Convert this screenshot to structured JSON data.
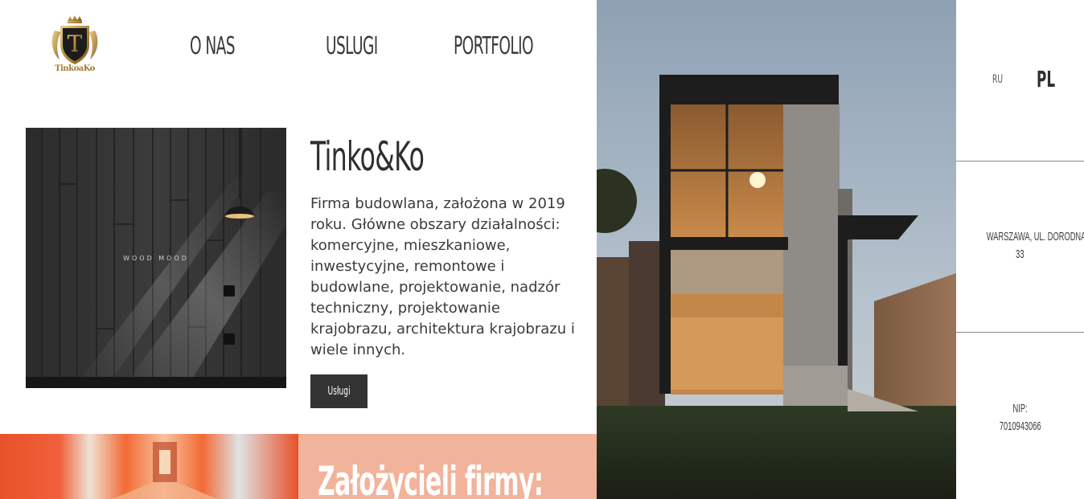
{
  "logo": {
    "text": "TinkoaKo",
    "letter": "T"
  },
  "nav": {
    "about": "O NAS",
    "services": "USLUGI",
    "portfolio": "PORTFOLIO"
  },
  "feature_image": {
    "caption": "WOOD MOOD"
  },
  "main": {
    "title": "Tinko&Ko",
    "description_lines": [
      "Firma budowlana, założona w 2019",
      "roku. Główne obszary działalności:",
      "komercyjne, mieszkaniowe,",
      "inwestycyjne, remontowe i",
      "budowlane, projektowanie, nadzór",
      "techniczny, projektowanie",
      "krajobrazu, architektura krajobrazu i",
      "wiele innych."
    ],
    "button_label": "Usługi"
  },
  "founders": {
    "title": "Założycieli firmy:"
  },
  "sidebar": {
    "lang_ru": "RU",
    "lang_pl": "PL",
    "address_line1": "WARSZAWA, UL. DORODNA",
    "address_line2": "33",
    "nip_label": "NIP:",
    "nip_value": "7010943066"
  },
  "colors": {
    "dark": "#333333",
    "peach": "#f2b39b",
    "orange": "#e8532a"
  }
}
